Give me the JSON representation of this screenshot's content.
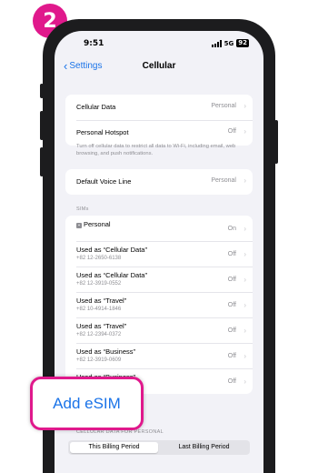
{
  "step_number": "2",
  "status_bar": {
    "time": "9:51",
    "network": "5G",
    "battery": "92"
  },
  "nav": {
    "back_label": "Settings",
    "title": "Cellular"
  },
  "group1": [
    {
      "label": "Cellular Data",
      "value": "Personal"
    },
    {
      "label": "Personal Hotspot",
      "value": "Off"
    }
  ],
  "cellular_note": "Turn off cellular data to restrict all data to Wi-Fi, including email, web browsing, and push notifications.",
  "voice_line": {
    "label": "Default Voice Line",
    "value": "Personal"
  },
  "sims_header": "SIMs",
  "sims": [
    {
      "label": "Personal",
      "number": "",
      "value": "On",
      "icon": "sim-card-icon"
    },
    {
      "label": "Used as “Cellular Data”",
      "number": "+82 12-2650-6138",
      "value": "Off"
    },
    {
      "label": "Used as “Cellular Data”",
      "number": "+82 12-3919-0552",
      "value": "Off"
    },
    {
      "label": "Used as “Travel”",
      "number": "+82 10-4914-1846",
      "value": "Off"
    },
    {
      "label": "Used as “Travel”",
      "number": "+82 12-2394-0372",
      "value": "Off"
    },
    {
      "label": "Used as “Business”",
      "number": "+82 12-3919-0609",
      "value": "Off"
    },
    {
      "label": "Used as “Business”",
      "number": "",
      "value": "Off"
    }
  ],
  "add_esim_label": "Add eSIM",
  "cellular_data_section": "CELLULAR DATA FOR PERSONAL",
  "billing_tabs": [
    "This Billing Period",
    "Last Billing Period"
  ],
  "colors": {
    "accent": "#e0198c",
    "link": "#1a73e8"
  }
}
